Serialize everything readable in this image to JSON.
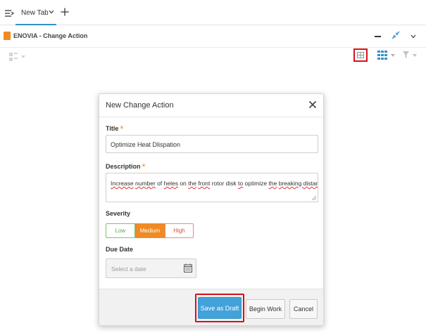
{
  "tab": {
    "label": "New Tab"
  },
  "app": {
    "title": "ENOVIA - Change Action",
    "accent_color": "#f08a24"
  },
  "dialog": {
    "title": "New Change Action",
    "fields": {
      "title_label": "Title",
      "title_value": "Optimize Heat Dlispation",
      "description_label": "Description",
      "description_words": [
        {
          "text": "Increase",
          "misspelled": true
        },
        {
          "text": " ",
          "misspelled": false
        },
        {
          "text": "number",
          "misspelled": true
        },
        {
          "text": " of ",
          "misspelled": false
        },
        {
          "text": "heles",
          "misspelled": true
        },
        {
          "text": " on ",
          "misspelled": false
        },
        {
          "text": "the",
          "misspelled": true
        },
        {
          "text": " ",
          "misspelled": false
        },
        {
          "text": "front",
          "misspelled": true
        },
        {
          "text": " rotor disk ",
          "misspelled": false
        },
        {
          "text": "to",
          "misspelled": true
        },
        {
          "text": "  optimize ",
          "misspelled": false
        },
        {
          "text": "the",
          "misspelled": true
        },
        {
          "text": " ",
          "misspelled": false
        },
        {
          "text": "breaking distance",
          "misspelled": true
        }
      ],
      "severity_label": "Severity",
      "severity_options": [
        "Low",
        "Medium",
        "High"
      ],
      "severity_selected": "Medium",
      "due_date_label": "Due Date",
      "due_date_placeholder": "Select a date"
    },
    "buttons": {
      "save_draft": "Save as Draft",
      "begin_work": "Begin Work",
      "cancel": "Cancel"
    }
  },
  "icons": [
    "menu-icon",
    "chevron-down-icon",
    "add-icon",
    "app-logo",
    "minimize-icon",
    "collapse-icon",
    "grid-icon",
    "table-icon",
    "filter-icon",
    "close-icon",
    "calendar-icon"
  ],
  "colors": {
    "primary_button": "#42a2da",
    "highlight": "#d3121a",
    "medium_selected": "#f08a24"
  }
}
